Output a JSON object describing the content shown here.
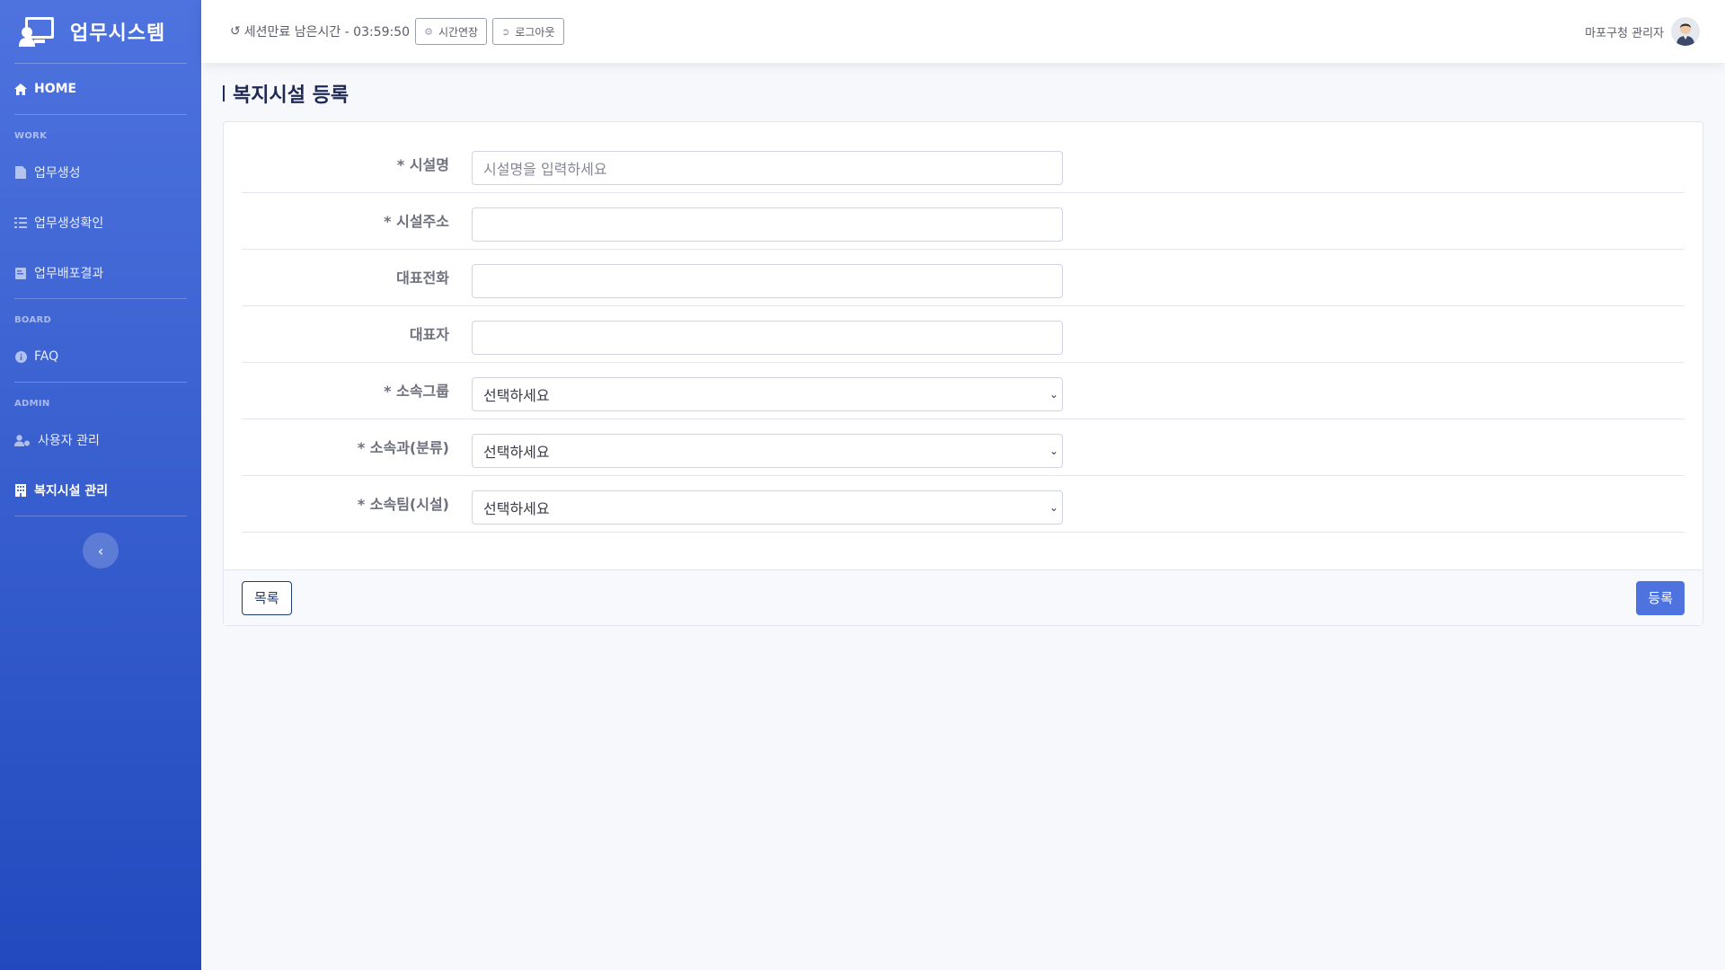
{
  "brand": {
    "title": "업무시스템",
    "icon": "chalkboard-teacher-icon"
  },
  "sidebar": {
    "home": {
      "label": "HOME",
      "icon": "home-icon"
    },
    "sections": [
      {
        "heading": "WORK",
        "items": [
          {
            "label": "업무생성",
            "icon": "file-add-icon"
          },
          {
            "label": "업무생성확인",
            "icon": "list-check-icon"
          },
          {
            "label": "업무배포결과",
            "icon": "file-text-icon"
          }
        ]
      },
      {
        "heading": "BOARD",
        "items": [
          {
            "label": "FAQ",
            "icon": "info-circle-icon"
          }
        ]
      },
      {
        "heading": "ADMIN",
        "items": [
          {
            "label": "사용자 관리",
            "icon": "user-cog-icon"
          },
          {
            "label": "복지시설 관리",
            "icon": "building-icon",
            "active": true
          }
        ]
      }
    ]
  },
  "topbar": {
    "session_text": "세션만료 남은시간 - 03:59:50",
    "extend_label": "시간연장",
    "logout_label": "로그아웃",
    "user_name": "마포구청 관리자"
  },
  "page": {
    "title": "복지시설 등록"
  },
  "form": {
    "fields": [
      {
        "label": "* 시설명",
        "type": "text",
        "placeholder": "시설명을 입력하세요",
        "value": ""
      },
      {
        "label": "* 시설주소",
        "type": "text",
        "placeholder": "",
        "value": ""
      },
      {
        "label": "대표전화",
        "type": "text",
        "placeholder": "",
        "value": ""
      },
      {
        "label": "대표자",
        "type": "text",
        "placeholder": "",
        "value": ""
      },
      {
        "label": "* 소속그룹",
        "type": "select",
        "value": "선택하세요"
      },
      {
        "label": "* 소속과(분류)",
        "type": "select",
        "value": "선택하세요"
      },
      {
        "label": "* 소속팀(시설)",
        "type": "select",
        "value": "선택하세요"
      }
    ]
  },
  "footer": {
    "list_label": "목록",
    "submit_label": "등록"
  },
  "colors": {
    "primary": "#4e73df",
    "sidebar_end": "#224abe",
    "title": "#1e2a55"
  }
}
